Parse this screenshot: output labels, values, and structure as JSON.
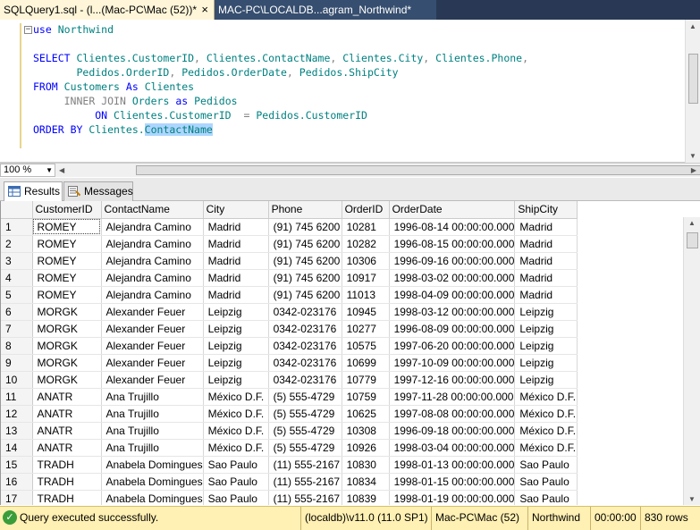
{
  "tabs": [
    {
      "label": "SQLQuery1.sql - (l...(Mac-PC\\Mac (52))*",
      "close": "×"
    },
    {
      "label": "MAC-PC\\LOCALDB...agram_Northwind*"
    }
  ],
  "editor": {
    "lines": [
      "use Northwind",
      "",
      "SELECT Clientes.CustomerID, Clientes.ContactName, Clientes.City, Clientes.Phone,",
      "       Pedidos.OrderID, Pedidos.OrderDate, Pedidos.ShipCity",
      "FROM Customers As Clientes",
      "     INNER JOIN Orders as Pedidos",
      "          ON Clientes.CustomerID  = Pedidos.CustomerID",
      "ORDER BY Clientes.ContactName"
    ],
    "collapse_glyph": "−"
  },
  "zoom": {
    "value": "100 %"
  },
  "result_tabs": {
    "results": "Results",
    "messages": "Messages"
  },
  "grid": {
    "columns": [
      "CustomerID",
      "ContactName",
      "City",
      "Phone",
      "OrderID",
      "OrderDate",
      "ShipCity"
    ],
    "rows": [
      [
        "1",
        "ROMEY",
        "Alejandra Camino",
        "Madrid",
        "(91) 745 6200",
        "10281",
        "1996-08-14 00:00:00.000",
        "Madrid"
      ],
      [
        "2",
        "ROMEY",
        "Alejandra Camino",
        "Madrid",
        "(91) 745 6200",
        "10282",
        "1996-08-15 00:00:00.000",
        "Madrid"
      ],
      [
        "3",
        "ROMEY",
        "Alejandra Camino",
        "Madrid",
        "(91) 745 6200",
        "10306",
        "1996-09-16 00:00:00.000",
        "Madrid"
      ],
      [
        "4",
        "ROMEY",
        "Alejandra Camino",
        "Madrid",
        "(91) 745 6200",
        "10917",
        "1998-03-02 00:00:00.000",
        "Madrid"
      ],
      [
        "5",
        "ROMEY",
        "Alejandra Camino",
        "Madrid",
        "(91) 745 6200",
        "11013",
        "1998-04-09 00:00:00.000",
        "Madrid"
      ],
      [
        "6",
        "MORGK",
        "Alexander Feuer",
        "Leipzig",
        "0342-023176",
        "10945",
        "1998-03-12 00:00:00.000",
        "Leipzig"
      ],
      [
        "7",
        "MORGK",
        "Alexander Feuer",
        "Leipzig",
        "0342-023176",
        "10277",
        "1996-08-09 00:00:00.000",
        "Leipzig"
      ],
      [
        "8",
        "MORGK",
        "Alexander Feuer",
        "Leipzig",
        "0342-023176",
        "10575",
        "1997-06-20 00:00:00.000",
        "Leipzig"
      ],
      [
        "9",
        "MORGK",
        "Alexander Feuer",
        "Leipzig",
        "0342-023176",
        "10699",
        "1997-10-09 00:00:00.000",
        "Leipzig"
      ],
      [
        "10",
        "MORGK",
        "Alexander Feuer",
        "Leipzig",
        "0342-023176",
        "10779",
        "1997-12-16 00:00:00.000",
        "Leipzig"
      ],
      [
        "11",
        "ANATR",
        "Ana Trujillo",
        "México D.F.",
        "(5) 555-4729",
        "10759",
        "1997-11-28 00:00:00.000",
        "México D.F."
      ],
      [
        "12",
        "ANATR",
        "Ana Trujillo",
        "México D.F.",
        "(5) 555-4729",
        "10625",
        "1997-08-08 00:00:00.000",
        "México D.F."
      ],
      [
        "13",
        "ANATR",
        "Ana Trujillo",
        "México D.F.",
        "(5) 555-4729",
        "10308",
        "1996-09-18 00:00:00.000",
        "México D.F."
      ],
      [
        "14",
        "ANATR",
        "Ana Trujillo",
        "México D.F.",
        "(5) 555-4729",
        "10926",
        "1998-03-04 00:00:00.000",
        "México D.F."
      ],
      [
        "15",
        "TRADH",
        "Anabela Domingues",
        "Sao Paulo",
        "(11) 555-2167",
        "10830",
        "1998-01-13 00:00:00.000",
        "Sao Paulo"
      ],
      [
        "16",
        "TRADH",
        "Anabela Domingues",
        "Sao Paulo",
        "(11) 555-2167",
        "10834",
        "1998-01-15 00:00:00.000",
        "Sao Paulo"
      ],
      [
        "17",
        "TRADH",
        "Anabela Domingues",
        "Sao Paulo",
        "(11) 555-2167",
        "10839",
        "1998-01-19 00:00:00.000",
        "Sao Paulo"
      ]
    ]
  },
  "status": {
    "message": "Query executed successfully.",
    "server": "(localdb)\\v11.0 (11.0 SP1)",
    "user": "Mac-PC\\Mac (52)",
    "database": "Northwind",
    "elapsed": "00:00:00",
    "rows": "830 rows"
  }
}
